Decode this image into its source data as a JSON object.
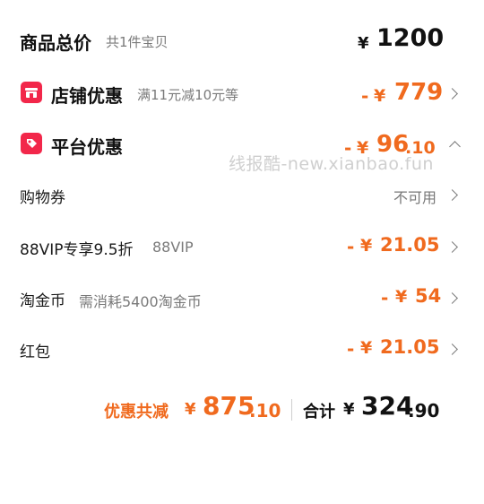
{
  "total": {
    "label": "商品总价",
    "count": "共1件宝贝",
    "currency": "¥",
    "amount": "1200"
  },
  "store_discount": {
    "label": "店铺优惠",
    "desc": "满11元减10元等",
    "sign": "-",
    "currency": "¥",
    "amount": "779",
    "icon": "shop-icon"
  },
  "platform_discount": {
    "label": "平台优惠",
    "sign": "-",
    "currency": "¥",
    "amount_int": "96",
    "amount_dec": ".10",
    "icon": "tag-icon"
  },
  "coupon": {
    "label": "购物券",
    "value": "不可用"
  },
  "vip": {
    "label": "88VIP专享9.5折",
    "tag": "88VIP",
    "sign": "-",
    "currency": "¥",
    "amount": "21.05"
  },
  "coins": {
    "label": "淘金币",
    "desc": "需消耗5400淘金币",
    "sign": "-",
    "currency": "¥",
    "amount": "54"
  },
  "red_packet": {
    "label": "红包",
    "sign": "-",
    "currency": "¥",
    "amount": "21.05"
  },
  "summary": {
    "discount_label": "优惠共减",
    "discount_currency": "¥",
    "discount_int": "875",
    "discount_dec": ".10",
    "total_label": "合计",
    "total_currency": "¥",
    "total_int": "324",
    "total_dec": ".90"
  },
  "watermark": "线报酷-new.xianbao.fun",
  "colors": {
    "accent": "#f06a1e",
    "icon_red": "#f2274a"
  }
}
